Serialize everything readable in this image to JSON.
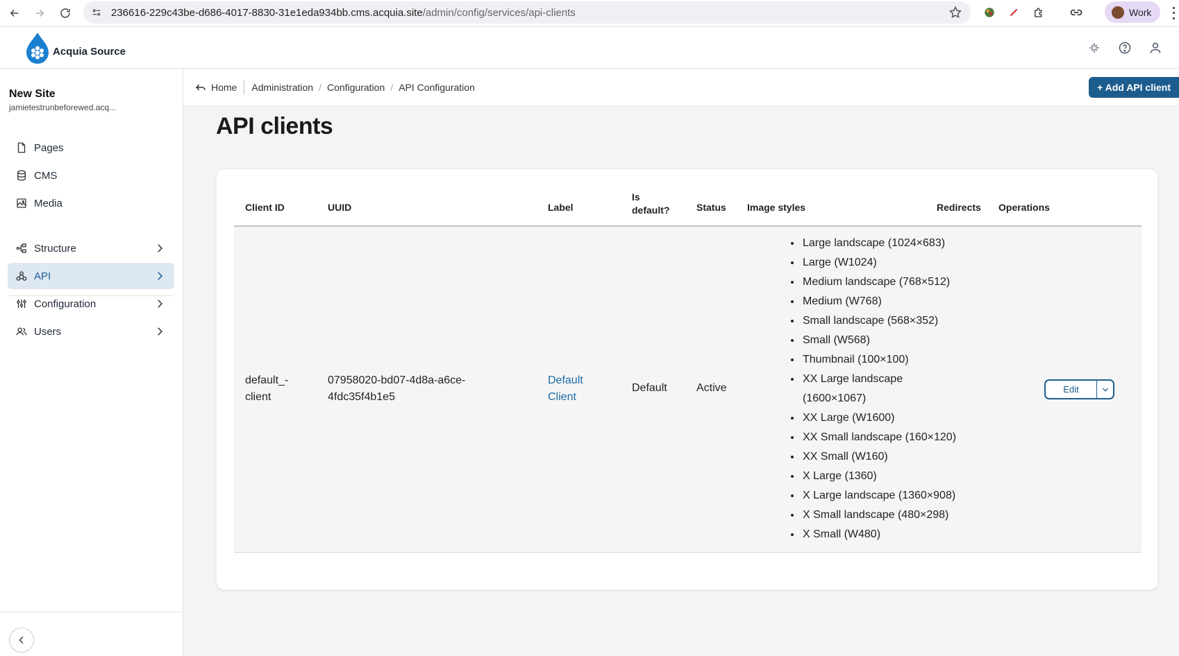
{
  "browser": {
    "url_host": "236616-229c43be-d686-4017-8830-31e1eda934bb.cms.acquia.site",
    "url_path": "/admin/config/services/api-clients",
    "profile_label": "Work"
  },
  "header": {
    "app_name": "Acquia Source",
    "brand_color": "#1b7fd0"
  },
  "sidebar": {
    "site_name": "New Site",
    "site_host": "jamietestrunbeforewed.acq...",
    "items": [
      {
        "label": "Pages",
        "icon": "page-icon"
      },
      {
        "label": "CMS",
        "icon": "database-icon"
      },
      {
        "label": "Media",
        "icon": "image-icon"
      },
      {
        "label": "Structure",
        "icon": "structure-icon"
      },
      {
        "label": "API",
        "icon": "api-icon"
      },
      {
        "label": "Configuration",
        "icon": "sliders-icon"
      },
      {
        "label": "Users",
        "icon": "users-icon"
      }
    ]
  },
  "breadcrumb": {
    "home": "Home",
    "items": [
      "Administration",
      "Configuration",
      "API Configuration"
    ]
  },
  "toolbar": {
    "add_label": "+ Add API client",
    "accent_color": "#1d5d8e"
  },
  "page": {
    "title": "API clients"
  },
  "table": {
    "headers": {
      "client_id": "Client ID",
      "uuid": "UUID",
      "label": "Label",
      "is_default_1": "Is",
      "is_default_2": "default?",
      "status": "Status",
      "image_styles": "Image styles",
      "redirects": "Redirects",
      "operations": "Operations"
    },
    "row": {
      "client_id_1": "default_-",
      "client_id_2": "client",
      "uuid_1": "07958020-bd07-4d8a-a6ce-",
      "uuid_2": "4fdc35f4b1e5",
      "label_1": "Default",
      "label_2": "Client",
      "is_default": "Default",
      "status": "Active",
      "image_styles": [
        "Large landscape (1024×683)",
        "Large (W1024)",
        "Medium landscape (768×512)",
        "Medium (W768)",
        "Small landscape (568×352)",
        "Small (W568)",
        "Thumbnail (100×100)",
        "XX Large landscape",
        "(1600×1067)",
        "XX Large (W1600)",
        "XX Small landscape (160×120)",
        "XX Small (W160)",
        "X Large (1360)",
        "X Large landscape (1360×908)",
        "X Small landscape (480×298)",
        "X Small (W480)"
      ],
      "edit_label": "Edit"
    }
  }
}
